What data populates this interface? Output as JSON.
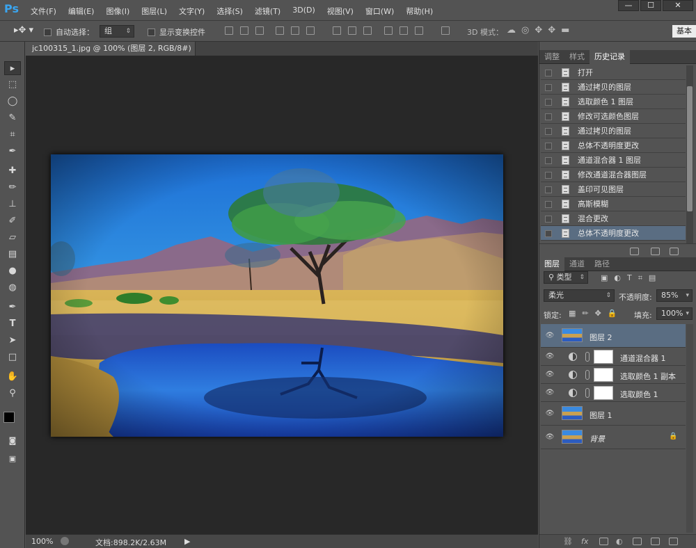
{
  "app": {
    "logo": "Ps",
    "accent": "#3aa5f0"
  },
  "menu": [
    "文件(F)",
    "编辑(E)",
    "图像(I)",
    "图层(L)",
    "文字(Y)",
    "选择(S)",
    "滤镜(T)",
    "3D(D)",
    "视图(V)",
    "窗口(W)",
    "帮助(H)"
  ],
  "window_buttons": {
    "minimize": "—",
    "maximize": "☐",
    "close": "✕"
  },
  "options": {
    "auto_select_label": "自动选择：",
    "auto_select_value": "组",
    "show_transform_label": "显示变换控件",
    "mode_3d_label": "3D 模式：",
    "workspace": "基本"
  },
  "document": {
    "tab_title": "jc100315_1.jpg @ 100% (图层 2, RGB/8#) *",
    "zoom": "100%",
    "doc_info": "文档:898.2K/2.63M"
  },
  "history_panel": {
    "tabs": [
      "调整",
      "样式",
      "历史记录"
    ],
    "active_tab": 2,
    "items": [
      "打开",
      "通过拷贝的图层",
      "选取颜色 1 图层",
      "修改可选颜色图层",
      "通过拷贝的图层",
      "总体不透明度更改",
      "通道混合器 1 图层",
      "修改通道混合器图层",
      "盖印可见图层",
      "高斯模糊",
      "混合更改",
      "总体不透明度更改"
    ],
    "selected_index": 11
  },
  "layers_panel": {
    "tabs": [
      "图层",
      "通道",
      "路径"
    ],
    "active_tab": 0,
    "filter_kind": "类型",
    "blend_mode": "柔光",
    "opacity_label": "不透明度:",
    "opacity_value": "85%",
    "lock_label": "锁定:",
    "fill_label": "填充:",
    "fill_value": "100%",
    "layers": [
      {
        "name": "图层 2",
        "type": "pixel",
        "selected": true,
        "visible": true
      },
      {
        "name": "通道混合器 1",
        "type": "adjustment",
        "visible": true
      },
      {
        "name": "选取颜色 1 副本",
        "type": "adjustment",
        "visible": true
      },
      {
        "name": "选取颜色 1",
        "type": "adjustment",
        "visible": true
      },
      {
        "name": "图层 1",
        "type": "pixel",
        "visible": true
      },
      {
        "name": "背景",
        "type": "background",
        "locked": true,
        "visible": true
      }
    ]
  },
  "colors": {
    "foreground": "#000000",
    "background": "#ffffff",
    "selection": "#5a6d82"
  }
}
